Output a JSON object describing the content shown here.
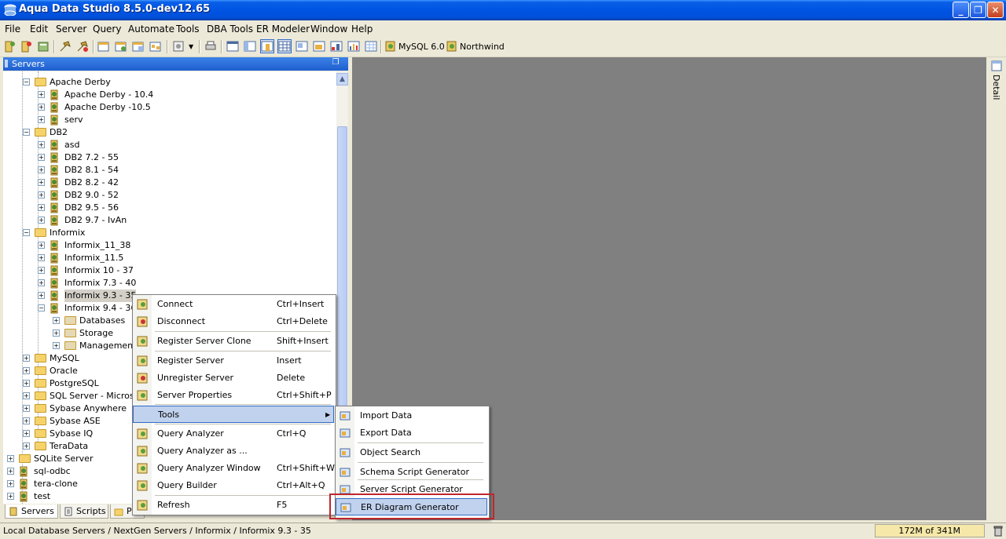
{
  "window": {
    "title": "Aqua Data Studio 8.5.0-dev12.65"
  },
  "menubar": [
    "File",
    "Edit",
    "Server",
    "Query",
    "Automate",
    "Tools",
    "DBA Tools",
    "ER Modeler",
    "Window",
    "Help"
  ],
  "toolbar": {
    "connection1": "MySQL 6.0",
    "connection2": "Northwind"
  },
  "panel": {
    "title": "Servers"
  },
  "tree": [
    {
      "label": "Apache Derby",
      "kind": "folder",
      "level": 2
    },
    {
      "label": "Apache Derby - 10.4",
      "kind": "server",
      "level": 3
    },
    {
      "label": "Apache Derby -10.5",
      "kind": "server",
      "level": 3
    },
    {
      "label": "serv",
      "kind": "server",
      "level": 3
    },
    {
      "label": "DB2",
      "kind": "folder",
      "level": 2
    },
    {
      "label": "asd",
      "kind": "server",
      "level": 3
    },
    {
      "label": "DB2 7.2 - 55",
      "kind": "server",
      "level": 3
    },
    {
      "label": "DB2 8.1 - 54",
      "kind": "server",
      "level": 3
    },
    {
      "label": "DB2 8.2 - 42",
      "kind": "server",
      "level": 3
    },
    {
      "label": "DB2 9.0 - 52",
      "kind": "server",
      "level": 3
    },
    {
      "label": "DB2 9.5 - 56",
      "kind": "server",
      "level": 3
    },
    {
      "label": "DB2 9.7 - IvAn",
      "kind": "server",
      "level": 3
    },
    {
      "label": "Informix",
      "kind": "folder",
      "level": 2
    },
    {
      "label": "Informix_11_38",
      "kind": "server",
      "level": 3
    },
    {
      "label": "Informix_11.5",
      "kind": "server",
      "level": 3
    },
    {
      "label": "Informix 10 - 37",
      "kind": "server",
      "level": 3
    },
    {
      "label": "Informix 7.3 - 40",
      "kind": "server",
      "level": 3
    },
    {
      "label": "Informix 9.3 - 35",
      "kind": "server",
      "level": 3,
      "selected": true
    },
    {
      "label": "Informix 9.4 - 36",
      "kind": "server",
      "level": 3
    },
    {
      "label": "Databases",
      "kind": "subfolder",
      "level": 4
    },
    {
      "label": "Storage",
      "kind": "subfolder",
      "level": 4
    },
    {
      "label": "Management",
      "kind": "subfolder",
      "level": 4
    },
    {
      "label": "MySQL",
      "kind": "folder",
      "level": 2
    },
    {
      "label": "Oracle",
      "kind": "folder",
      "level": 2
    },
    {
      "label": "PostgreSQL",
      "kind": "folder",
      "level": 2
    },
    {
      "label": "SQL Server - Microsoft",
      "kind": "folder",
      "level": 2
    },
    {
      "label": "Sybase Anywhere",
      "kind": "folder",
      "level": 2
    },
    {
      "label": "Sybase ASE",
      "kind": "folder",
      "level": 2
    },
    {
      "label": "Sybase IQ",
      "kind": "folder",
      "level": 2
    },
    {
      "label": "TeraData",
      "kind": "folder",
      "level": 2
    },
    {
      "label": "SQLite Server",
      "kind": "folder",
      "level": 1
    },
    {
      "label": "sql-odbc",
      "kind": "server",
      "level": 1
    },
    {
      "label": "tera-clone",
      "kind": "server",
      "level": 1
    },
    {
      "label": "test",
      "kind": "server",
      "level": 1
    }
  ],
  "bottom_tabs": [
    "Servers",
    "Scripts",
    "Projects"
  ],
  "context_menu": [
    {
      "label": "Connect",
      "shortcut": "Ctrl+Insert",
      "icon": "connect-icon"
    },
    {
      "label": "Disconnect",
      "shortcut": "Ctrl+Delete",
      "icon": "disconnect-icon"
    },
    {
      "label": "Register Server Clone",
      "shortcut": "Shift+Insert",
      "icon": "clone-icon"
    },
    {
      "label": "Register Server",
      "shortcut": "Insert",
      "icon": "register-icon"
    },
    {
      "label": "Unregister Server",
      "shortcut": "Delete",
      "icon": "unregister-icon"
    },
    {
      "label": "Server Properties",
      "shortcut": "Ctrl+Shift+P",
      "icon": "properties-icon"
    },
    {
      "label": "Tools",
      "shortcut": "",
      "icon": "",
      "submenu": true
    },
    {
      "label": "Query Analyzer",
      "shortcut": "Ctrl+Q",
      "icon": "query-analyzer-icon"
    },
    {
      "label": "Query Analyzer as ...",
      "shortcut": "",
      "icon": "query-analyzer-as-icon"
    },
    {
      "label": "Query Analyzer Window",
      "shortcut": "Ctrl+Shift+W",
      "icon": "query-window-icon"
    },
    {
      "label": "Query Builder",
      "shortcut": "Ctrl+Alt+Q",
      "icon": "query-builder-icon"
    },
    {
      "label": "Refresh",
      "shortcut": "F5",
      "icon": "refresh-icon"
    }
  ],
  "tools_submenu": [
    {
      "label": "Import Data",
      "icon": "import-icon"
    },
    {
      "label": "Export Data",
      "icon": "export-icon"
    },
    {
      "label": "Object Search",
      "icon": "object-search-icon"
    },
    {
      "label": "Schema Script Generator",
      "icon": "schema-script-icon"
    },
    {
      "label": "Server Script Generator",
      "icon": "server-script-icon"
    },
    {
      "label": "ER Diagram Generator",
      "icon": "er-diagram-icon",
      "highlighted": true
    }
  ],
  "detail_tab": "Detail",
  "status": {
    "path": "Local Database Servers / NextGen Servers / Informix / Informix 9.3 - 35",
    "memory": "172M of 341M"
  }
}
